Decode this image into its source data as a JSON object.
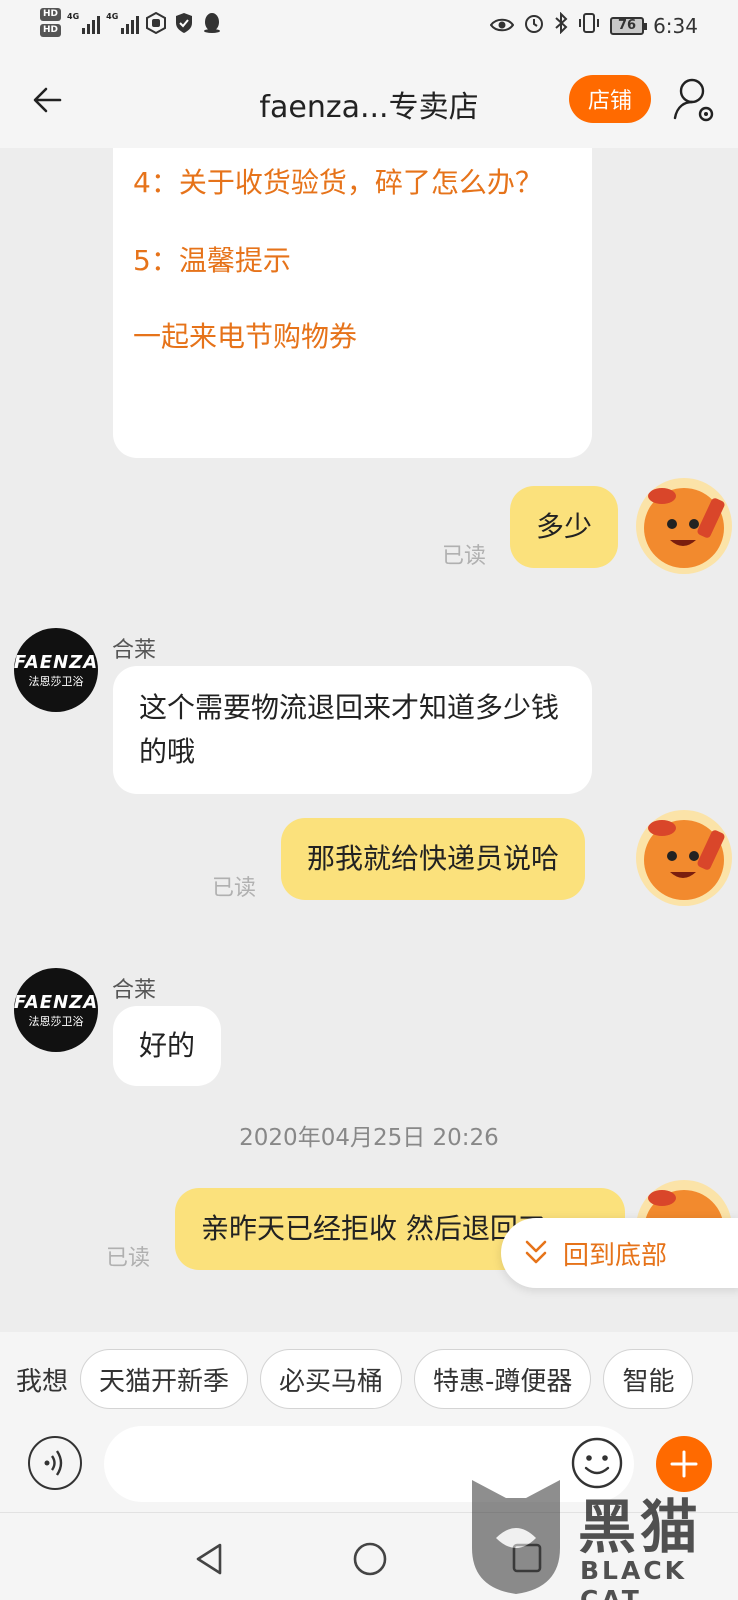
{
  "status_bar": {
    "time": "6:34",
    "battery": "76",
    "hd1": "HD",
    "hd2": "HD",
    "net1": "4G",
    "net2": "4G"
  },
  "header": {
    "title": "faenza...专卖店",
    "store_button": "店铺"
  },
  "chat": {
    "menu_items": [
      "4：关于收货验货，碎了怎么办？",
      "5：温馨提示",
      "一起来电节购物券"
    ],
    "messages": [
      {
        "from": "me",
        "text": "多少",
        "status": "已读"
      },
      {
        "from": "shop",
        "sender": "合莱",
        "text": "这个需要物流退回来才知道多少钱的哦"
      },
      {
        "from": "me",
        "text": "那我就给快递员说哈",
        "status": "已读"
      },
      {
        "from": "shop",
        "sender": "合莱",
        "text": "好的"
      },
      {
        "from": "me",
        "text": "亲昨天已经拒收 然后退回了",
        "status": "已读"
      }
    ],
    "timestamp": "2020年04月25日 20:26",
    "shop_avatar": {
      "logo": "FAENZA",
      "subtitle": "法恩莎卫浴"
    },
    "jump_button": "回到底部"
  },
  "quick_bar": {
    "prefix": "我想",
    "chips": [
      "天猫开新季",
      "必买马桶",
      "特惠-蹲便器",
      "智能"
    ]
  },
  "input": {
    "placeholder": ""
  },
  "watermark": {
    "main": "黑猫",
    "sub": "BLACK CAT"
  },
  "colors": {
    "accent": "#ff6a00",
    "my_bubble": "#fbe17c",
    "menu_text": "#e6731a"
  }
}
